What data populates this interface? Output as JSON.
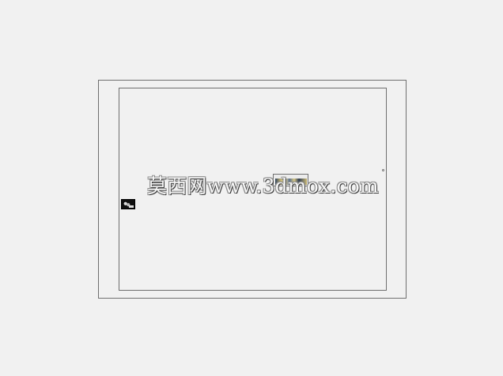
{
  "watermark": {
    "text": "莫西网www.3dmox.com"
  },
  "thumbnails": [
    {
      "icon": "image-thumbnail-icon"
    },
    {
      "icon": "image-thumbnail-icon"
    }
  ],
  "markers": [
    {
      "icon": "circle-icon"
    }
  ],
  "colors": {
    "background": "#f1f1f1",
    "frame_line": "#6f6f6f"
  }
}
